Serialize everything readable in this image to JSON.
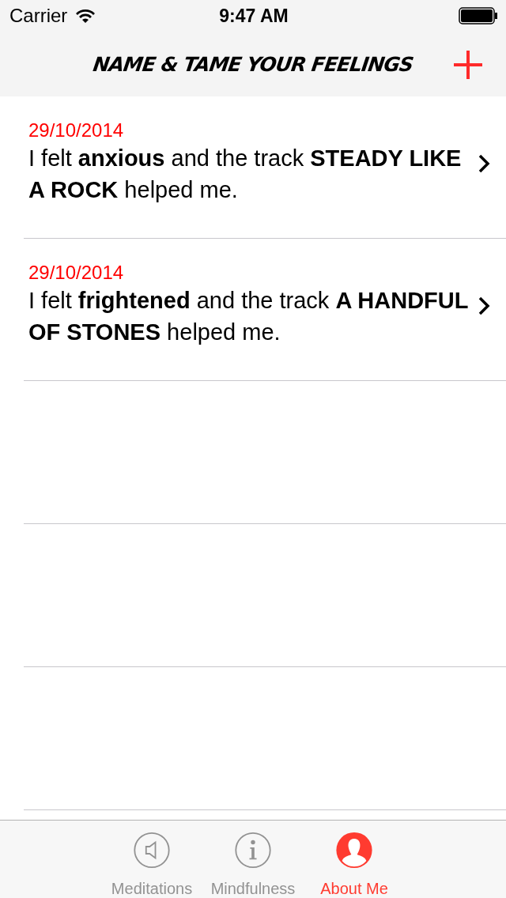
{
  "status_bar": {
    "carrier": "Carrier",
    "time": "9:47 AM"
  },
  "nav_bar": {
    "title": "NAME & TAME YOUR FEELINGS"
  },
  "entries": [
    {
      "date": "29/10/2014",
      "text": "I felt **anxious** and the track **STEADY LIKE A ROCK** helped me."
    },
    {
      "date": "29/10/2014",
      "text": "I felt **frightened** and the track **A HANDFUL OF STONES** helped me."
    }
  ],
  "tab_bar": [
    {
      "kind": "speaker",
      "label": "Meditations",
      "selected": false
    },
    {
      "kind": "info",
      "label": "Mindfulness",
      "selected": false
    },
    {
      "kind": "person",
      "label": "About Me",
      "selected": true
    }
  ]
}
